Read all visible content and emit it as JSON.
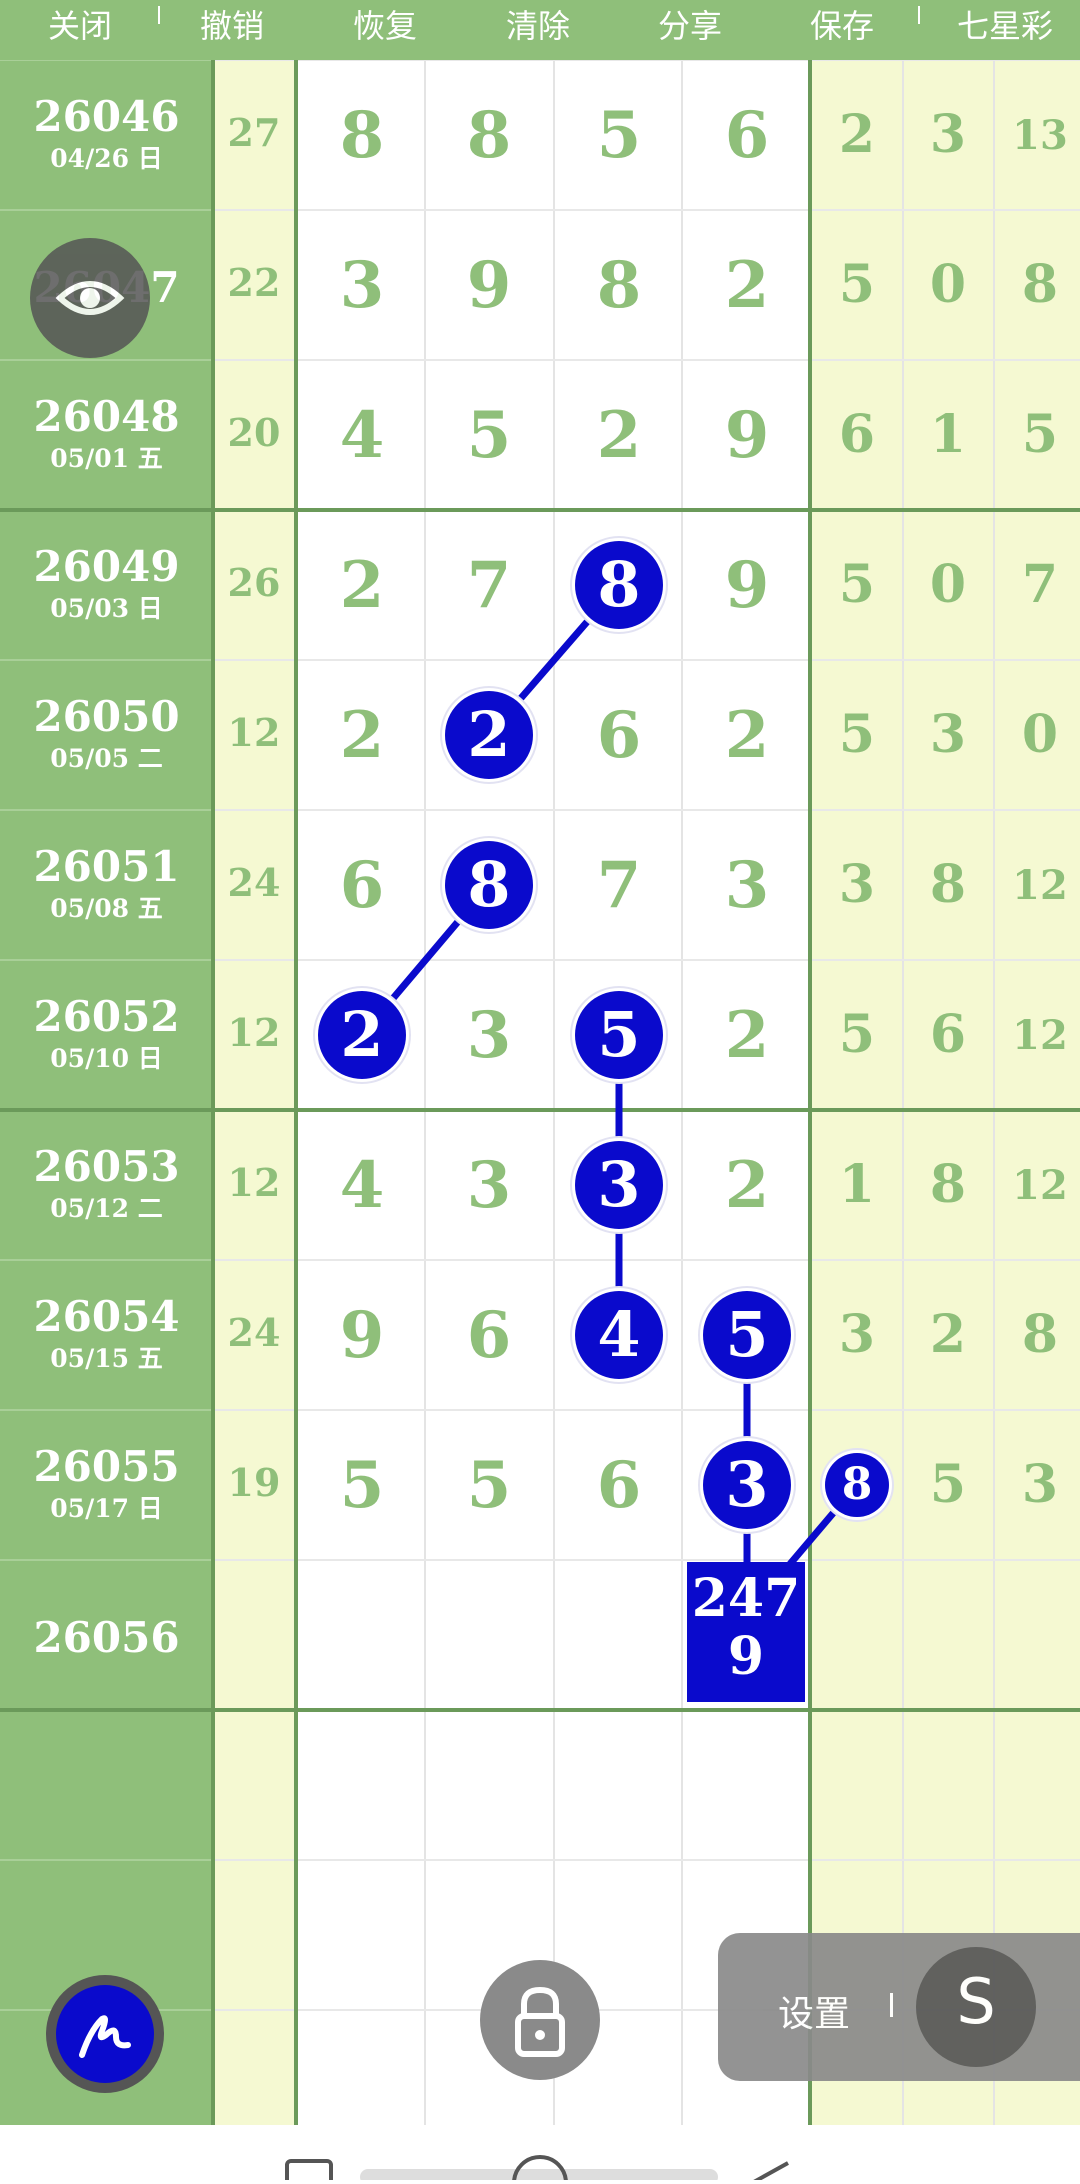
{
  "toolbar": {
    "close": "关闭",
    "undo": "撤销",
    "redo": "恢复",
    "clear": "清除",
    "share": "分享",
    "save": "保存",
    "lottery": "七星彩"
  },
  "rows": [
    {
      "issue": "26046",
      "date": "04/26 日",
      "sum": "27",
      "digits": [
        "8",
        "8",
        "5",
        "6"
      ],
      "tail": [
        "2",
        "3",
        "13"
      ]
    },
    {
      "issue": "26047",
      "date": "",
      "sum": "22",
      "digits": [
        "3",
        "9",
        "8",
        "2"
      ],
      "tail": [
        "5",
        "0",
        "8"
      ]
    },
    {
      "issue": "26048",
      "date": "05/01 五",
      "sum": "20",
      "digits": [
        "4",
        "5",
        "2",
        "9"
      ],
      "tail": [
        "6",
        "1",
        "5"
      ]
    },
    {
      "issue": "26049",
      "date": "05/03 日",
      "sum": "26",
      "digits": [
        "2",
        "7",
        "8",
        "9"
      ],
      "tail": [
        "5",
        "0",
        "7"
      ]
    },
    {
      "issue": "26050",
      "date": "05/05 二",
      "sum": "12",
      "digits": [
        "2",
        "2",
        "6",
        "2"
      ],
      "tail": [
        "5",
        "3",
        "0"
      ]
    },
    {
      "issue": "26051",
      "date": "05/08 五",
      "sum": "24",
      "digits": [
        "6",
        "8",
        "7",
        "3"
      ],
      "tail": [
        "3",
        "8",
        "12"
      ]
    },
    {
      "issue": "26052",
      "date": "05/10 日",
      "sum": "12",
      "digits": [
        "2",
        "3",
        "5",
        "2"
      ],
      "tail": [
        "5",
        "6",
        "12"
      ]
    },
    {
      "issue": "26053",
      "date": "05/12 二",
      "sum": "12",
      "digits": [
        "4",
        "3",
        "3",
        "2"
      ],
      "tail": [
        "1",
        "8",
        "12"
      ]
    },
    {
      "issue": "26054",
      "date": "05/15 五",
      "sum": "24",
      "digits": [
        "9",
        "6",
        "4",
        "5"
      ],
      "tail": [
        "3",
        "2",
        "8"
      ]
    },
    {
      "issue": "26055",
      "date": "05/17 日",
      "sum": "19",
      "digits": [
        "5",
        "5",
        "6",
        "3"
      ],
      "tail": [
        "8",
        "5",
        "3"
      ]
    },
    {
      "issue": "26056",
      "date": "",
      "sum": "",
      "digits": [
        "",
        "",
        "",
        ""
      ],
      "tail": [
        "",
        "",
        ""
      ]
    }
  ],
  "highlighted": [
    {
      "row": 3,
      "col": 2
    },
    {
      "row": 4,
      "col": 1
    },
    {
      "row": 5,
      "col": 1
    },
    {
      "row": 6,
      "col": 0
    },
    {
      "row": 6,
      "col": 2
    },
    {
      "row": 7,
      "col": 2
    },
    {
      "row": 8,
      "col": 2
    },
    {
      "row": 8,
      "col": 3
    },
    {
      "row": 9,
      "col": 3
    },
    {
      "row": 9,
      "col": 4
    }
  ],
  "prediction": {
    "line1": "247",
    "line2": "9"
  },
  "settings_label": "设置",
  "icons": {
    "eye": "eye-icon",
    "pen": "pen-icon",
    "lock": "lock-icon",
    "s": "s-icon"
  },
  "s_glyph": "S",
  "colors": {
    "green": "#8fbf7a",
    "light_yellow": "#f5f9d2",
    "blue": "#0a0acc",
    "line_dark": "#6b9a5a"
  }
}
